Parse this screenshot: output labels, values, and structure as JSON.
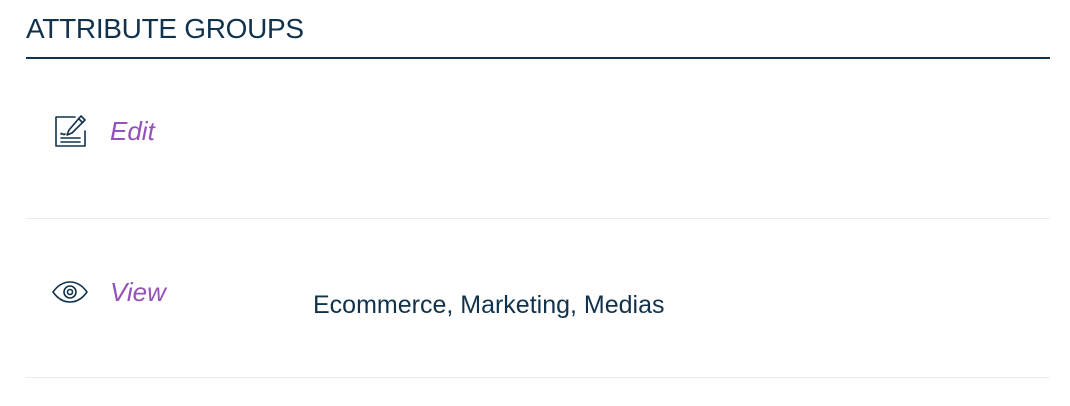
{
  "section": {
    "title": "ATTRIBUTE GROUPS"
  },
  "permissions": [
    {
      "label": "Edit",
      "icon": "edit-icon",
      "groups": ""
    },
    {
      "label": "View",
      "icon": "eye-icon",
      "groups": "Ecommerce, Marketing, Medias"
    }
  ],
  "colors": {
    "text": "#11324d",
    "accent": "#9452ba",
    "divider": "#e8ebee"
  }
}
